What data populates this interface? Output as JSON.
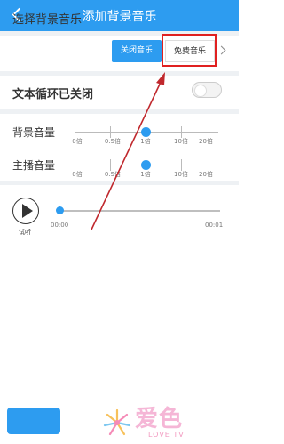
{
  "header": {
    "title": "添加背景音乐",
    "back_icon": "chevron-left-icon"
  },
  "background_music": {
    "label": "选择背景音乐",
    "options": [
      "关闭音乐",
      "免费音乐"
    ],
    "selected": "关闭音乐",
    "highlighted": "免费音乐"
  },
  "loop": {
    "label": "文本循环已关闭",
    "enabled": false
  },
  "volume": {
    "tick_labels": [
      "0倍",
      "0.5倍",
      "1倍",
      "10倍",
      "20倍"
    ],
    "background": {
      "label": "背景音量",
      "value": "1倍"
    },
    "host": {
      "label": "主播音量",
      "value": "1倍"
    }
  },
  "preview": {
    "label": "试听",
    "current_time": "00:00",
    "total_time": "00:01",
    "progress": 0
  },
  "watermark": {
    "main": "爱色",
    "sub": "LOVE TV"
  },
  "colors": {
    "accent": "#2d9cf0",
    "highlight": "#e02020",
    "annotation": "#c0282d",
    "watermark": "#f5b6d6"
  }
}
